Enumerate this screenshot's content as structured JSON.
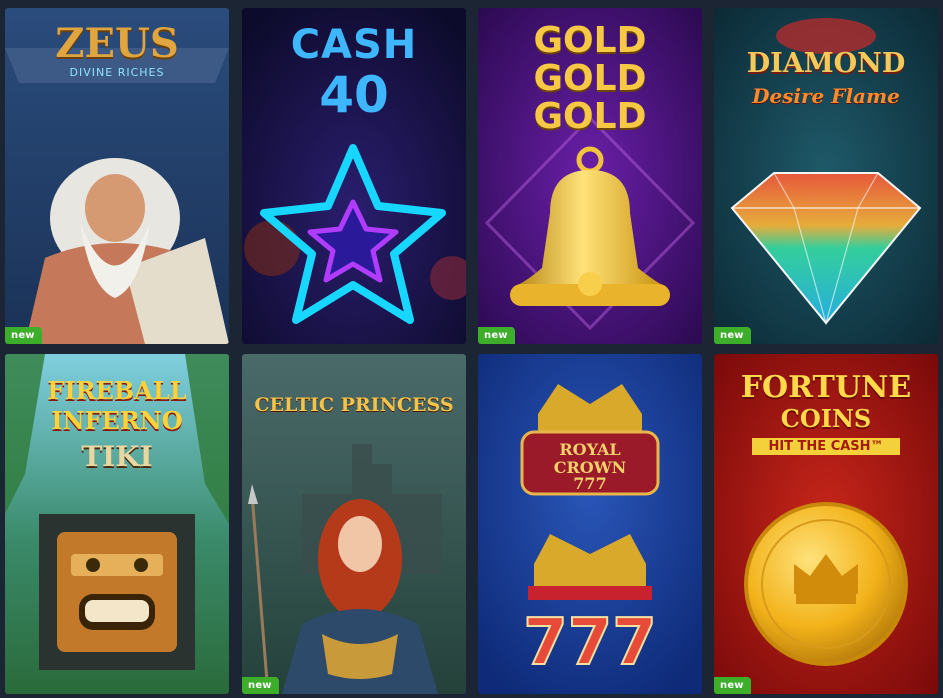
{
  "badge_label": "new",
  "games": [
    {
      "title": "ZEUS",
      "subtitle": "DIVINE RICHES",
      "new": true,
      "icon": "zeus-icon"
    },
    {
      "title": "CASH",
      "subtitle": "40",
      "new": false,
      "icon": "star-icon"
    },
    {
      "title": "GOLD",
      "title2": "GOLD",
      "title3": "GOLD",
      "new": true,
      "icon": "bell-icon"
    },
    {
      "title": "DIAMOND",
      "subtitle": "Desire Flame",
      "new": true,
      "icon": "diamond-icon"
    },
    {
      "title": "FIREBALL",
      "title2": "INFERNO",
      "subtitle": "TIKI",
      "new": false,
      "icon": "tiki-mask-icon"
    },
    {
      "title": "CELTIC PRINCESS",
      "new": true,
      "icon": "princess-icon"
    },
    {
      "title": "ROYAL",
      "title2": "CROWN",
      "subtitle": "777",
      "new": false,
      "icon": "crown-icon"
    },
    {
      "title": "FORTUNE",
      "title2": "COINS",
      "subtitle": "HIT THE CASH™",
      "new": true,
      "icon": "coin-icon"
    }
  ],
  "colors": {
    "badge": "#3cae2a",
    "page_bg": "#1b2533"
  }
}
